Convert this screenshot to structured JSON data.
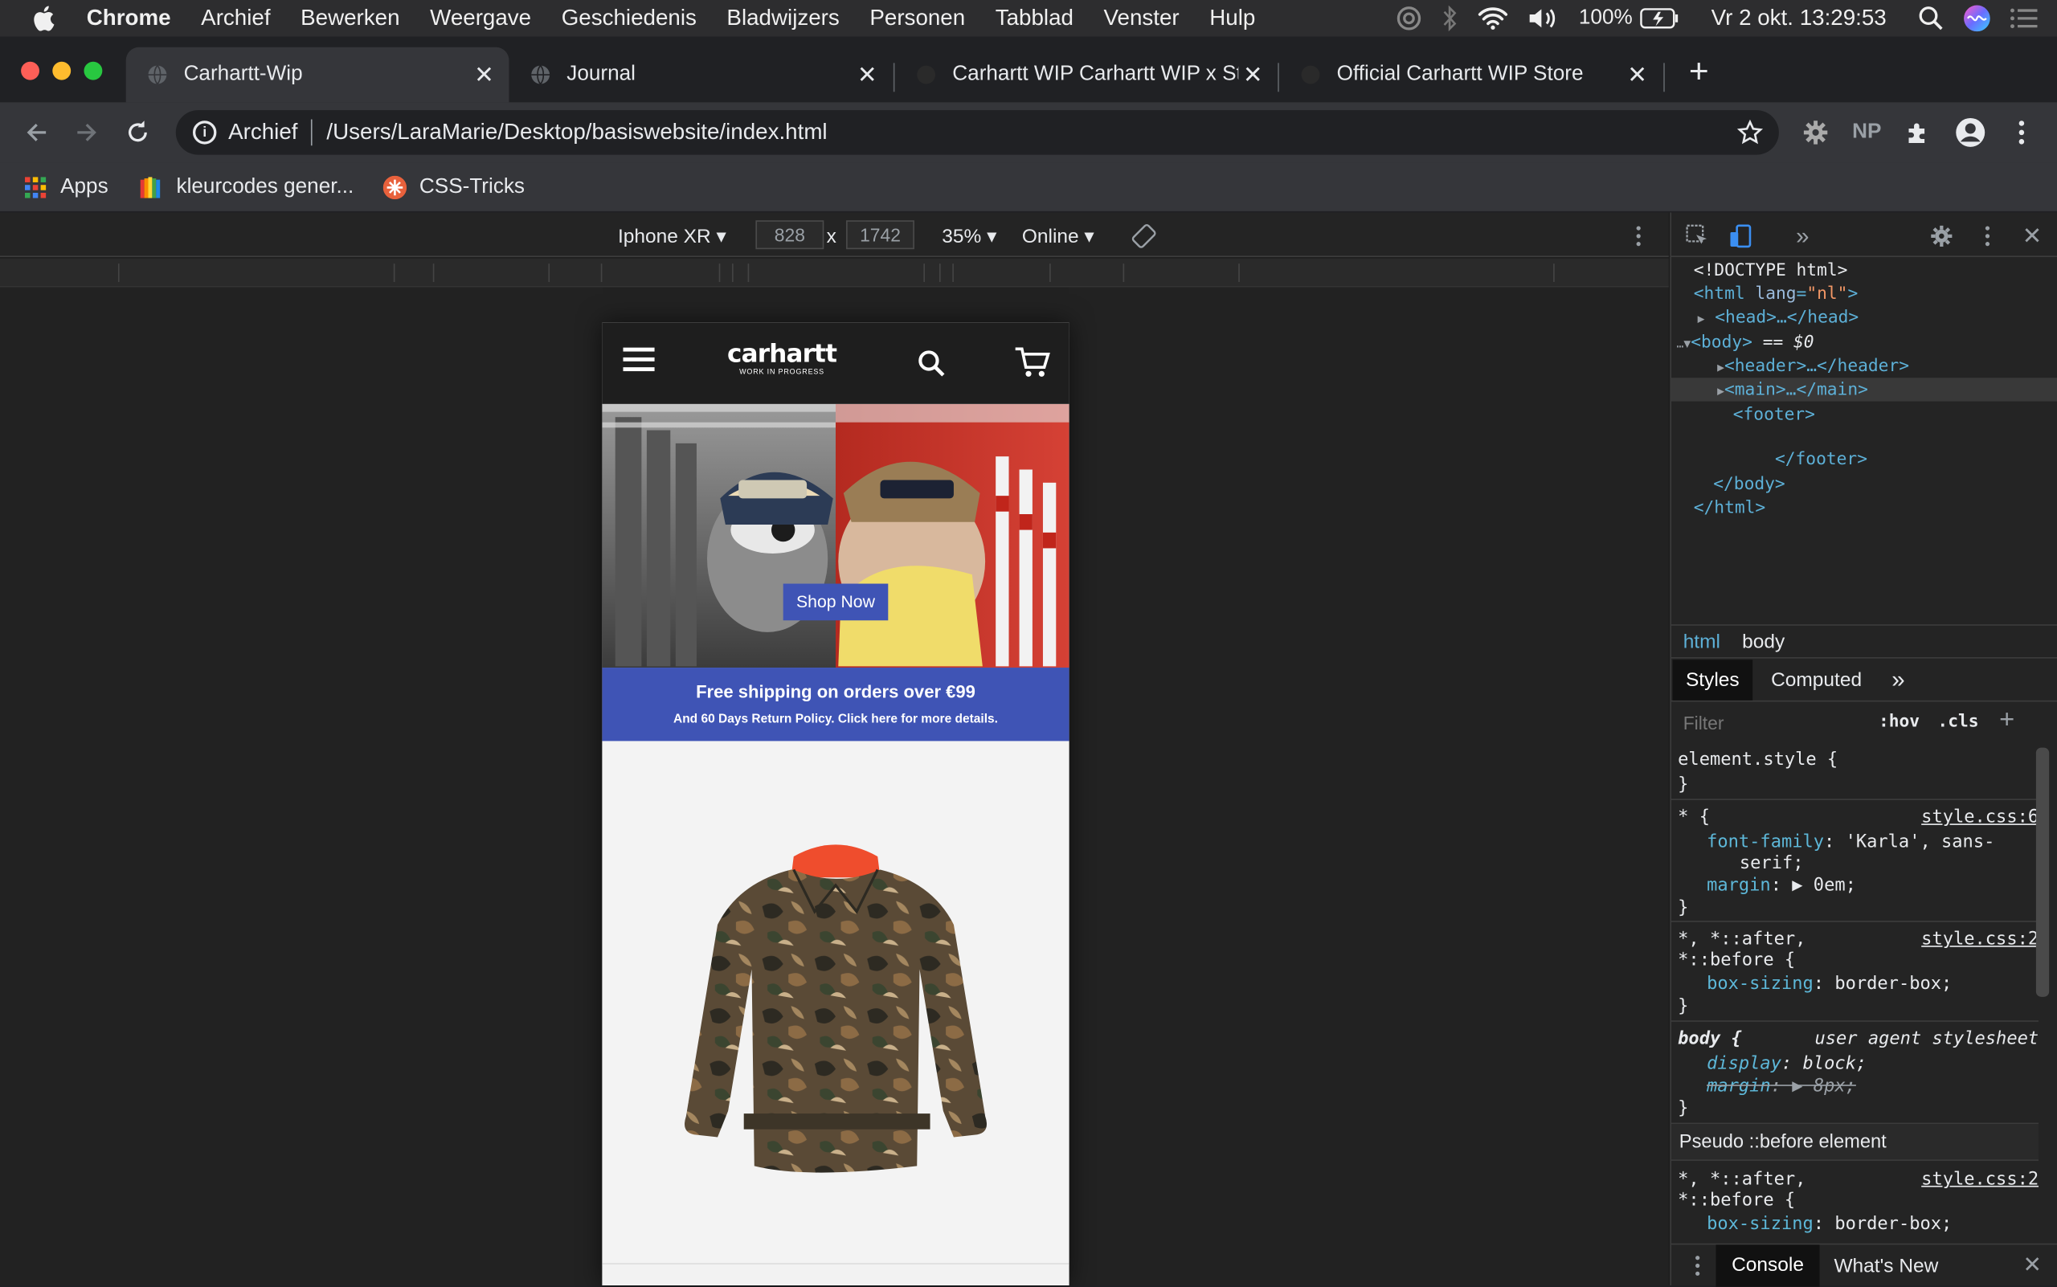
{
  "menubar": {
    "app": "Chrome",
    "items": [
      "Archief",
      "Bewerken",
      "Weergave",
      "Geschiedenis",
      "Bladwijzers",
      "Personen",
      "Tabblad",
      "Venster",
      "Hulp"
    ],
    "battery": "100%",
    "datetime": "Vr 2 okt.  13:29:53"
  },
  "tabs": [
    {
      "title": "Carhartt-Wip",
      "active": true
    },
    {
      "title": "Journal",
      "active": false
    },
    {
      "title": "Carhartt WIP Carhartt WIP x St",
      "active": false
    },
    {
      "title": "Official Carhartt WIP Store",
      "active": false
    }
  ],
  "omnibox": {
    "secure_label": "Archief",
    "url": "/Users/LaraMarie/Desktop/basiswebsite/index.html"
  },
  "bookmarks": [
    {
      "label": "Apps"
    },
    {
      "label": "kleurcodes gener..."
    },
    {
      "label": "CSS-Tricks"
    }
  ],
  "device": {
    "name": "Iphone XR",
    "width": "828",
    "height": "1742",
    "zoom": "35%",
    "network": "Online",
    "times": "x"
  },
  "site": {
    "logo": "carhartt",
    "logo_sub": "WORK IN PROGRESS",
    "cta": "Shop Now",
    "banner_title": "Free shipping on orders over €99",
    "banner_sub": "And 60 Days Return Policy. Click here for more details."
  },
  "devtools": {
    "dom": {
      "doctype": "<!DOCTYPE html>",
      "html_open": "<html ",
      "lang_attr": "lang",
      "lang_val": "\"nl\"",
      "head": "<head>…</head>",
      "body_open": "<body>",
      "body_eq": " == $0",
      "header": "<header>…</header>",
      "main": "<main>…</main>",
      "footer_open": "<footer>",
      "footer_close": "</footer>",
      "body_close": "</body>",
      "html_close": "</html>",
      "dots": "…"
    },
    "crumbs": [
      "html",
      "body"
    ],
    "tabs": [
      "Styles",
      "Computed"
    ],
    "filter_placeholder": "Filter",
    "hov": ":hov",
    "cls": ".cls",
    "styles": {
      "element_style": "element.style {",
      "close": "}",
      "r1_sel": "* {",
      "r1_src": "style.css:6",
      "r1_p1": "font-family",
      "r1_v1": ": 'Karla', sans-",
      "r1_v1b": "serif;",
      "r1_p2": "margin",
      "r1_v2": ": ▶ 0em;",
      "r2_sel1": "*, *::after,",
      "r2_sel2": "*::before {",
      "r2_src": "style.css:2",
      "r2_p1": "box-sizing",
      "r2_v1": ": border-box;",
      "r3_sel": "body {",
      "r3_src": "user agent stylesheet",
      "r3_p1": "display",
      "r3_v1": ": block;",
      "r3_p2": "margin",
      "r3_v2": ": ▶ 8px;",
      "pseudo": "Pseudo ::before element"
    },
    "console_tabs": [
      "Console",
      "What's New"
    ]
  }
}
